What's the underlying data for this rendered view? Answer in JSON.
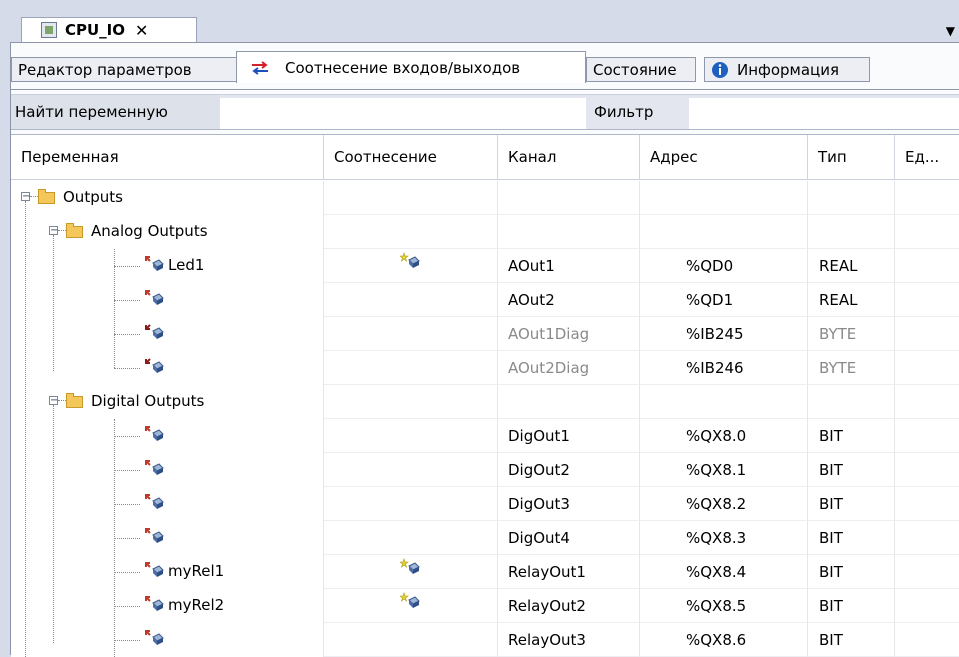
{
  "editor_tab": {
    "title": "CPU_IO",
    "close": "✕"
  },
  "tabs": [
    {
      "label": "Редактор параметров"
    },
    {
      "label": "Соотнесение входов/выходов"
    },
    {
      "label": "Состояние"
    },
    {
      "label": "Информация"
    }
  ],
  "filter_bar": {
    "find_label": "Найти переменную",
    "filter_label": "Фильтр",
    "find_value": "",
    "filter_value": ""
  },
  "columns": [
    "Переменная",
    "Соотнесение",
    "Канал",
    "Адрес",
    "Тип",
    "Ед..."
  ],
  "rows": [
    {
      "name": "Outputs",
      "channel": "",
      "address": "",
      "type": ""
    },
    {
      "name": "Analog Outputs",
      "channel": "",
      "address": "",
      "type": ""
    },
    {
      "name": "Led1",
      "channel": "AOut1",
      "address": "%QD0",
      "type": "REAL"
    },
    {
      "name": "",
      "channel": "AOut2",
      "address": "%QD1",
      "type": "REAL"
    },
    {
      "name": "",
      "channel": "AOut1Diag",
      "address": "%IB245",
      "type": "BYTE"
    },
    {
      "name": "",
      "channel": "AOut2Diag",
      "address": "%IB246",
      "type": "BYTE"
    },
    {
      "name": "Digital Outputs",
      "channel": "",
      "address": "",
      "type": ""
    },
    {
      "name": "",
      "channel": "DigOut1",
      "address": "%QX8.0",
      "type": "BIT"
    },
    {
      "name": "",
      "channel": "DigOut2",
      "address": "%QX8.1",
      "type": "BIT"
    },
    {
      "name": "",
      "channel": "DigOut3",
      "address": "%QX8.2",
      "type": "BIT"
    },
    {
      "name": "",
      "channel": "DigOut4",
      "address": "%QX8.3",
      "type": "BIT"
    },
    {
      "name": "myRel1",
      "channel": "RelayOut1",
      "address": "%QX8.4",
      "type": "BIT"
    },
    {
      "name": "myRel2",
      "channel": "RelayOut2",
      "address": "%QX8.5",
      "type": "BIT"
    },
    {
      "name": "",
      "channel": "RelayOut3",
      "address": "%QX8.6",
      "type": "BIT"
    }
  ],
  "colors": {
    "folder": "#f3c75a",
    "output_arrow": "#c0392b",
    "input_arrow": "#8b1a1a",
    "info": "#1f5fbf",
    "swap_red": "#d4202a",
    "swap_blue": "#1f4fbf"
  },
  "icons": {
    "doc": "device-icon",
    "mapping_tab": "swap-arrows-icon",
    "info_tab": "info-icon",
    "expander": "tree-expander-icon",
    "folder": "folder-icon",
    "channel": "io-channel-icon",
    "mapped": "mapped-variable-icon"
  }
}
